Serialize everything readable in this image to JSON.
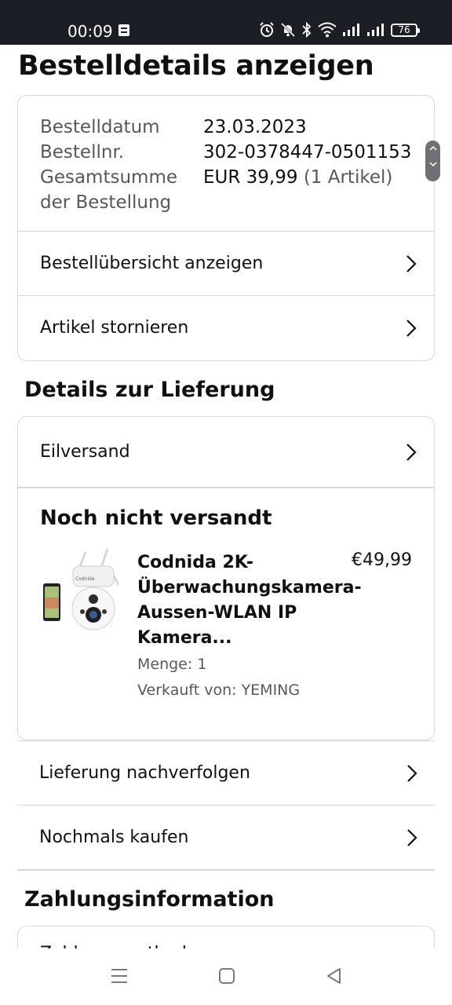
{
  "status_bar": {
    "time": "00:09",
    "battery": "76"
  },
  "page_title": "Bestelldetails anzeigen",
  "order_summary": {
    "rows": [
      {
        "label": "Bestelldatum",
        "value": "23.03.2023"
      },
      {
        "label": "Bestellnr.",
        "value": "302-0378447-0501153"
      },
      {
        "label": "Gesamtsumme der Bestellung",
        "value": "EUR 39,99",
        "value_muted": "(1 Artikel)"
      }
    ],
    "links": [
      {
        "label": "Bestellübersicht anzeigen"
      },
      {
        "label": "Artikel stornieren"
      }
    ]
  },
  "delivery": {
    "section_title": "Details zur Lieferung",
    "shipping_method": "Eilversand",
    "status": "Noch nicht versandt",
    "product": {
      "title": "Codnida 2K-Überwachungskamera-Aussen-WLAN IP Kamera...",
      "price": "€49,99",
      "quantity": "Menge: 1",
      "seller": "Verkauft von: YEMING",
      "image_brand": "Codnida"
    }
  },
  "actions": [
    {
      "label": "Lieferung nachverfolgen"
    },
    {
      "label": "Nochmals kaufen"
    }
  ],
  "payment": {
    "section_title": "Zahlungsinformation",
    "partial_text": "Zahlungsmethode"
  },
  "icons": {
    "chevron": "chevron-right-icon",
    "alarm": "alarm-icon",
    "mute": "bell-off-icon",
    "bluetooth": "bluetooth-icon",
    "wifi": "wifi-icon",
    "signal": "signal-icon"
  },
  "colors": {
    "status_bar_bg": "#1b1e24",
    "border": "#d5d9d9",
    "text_primary": "#0f1111",
    "text_secondary": "#565959"
  }
}
